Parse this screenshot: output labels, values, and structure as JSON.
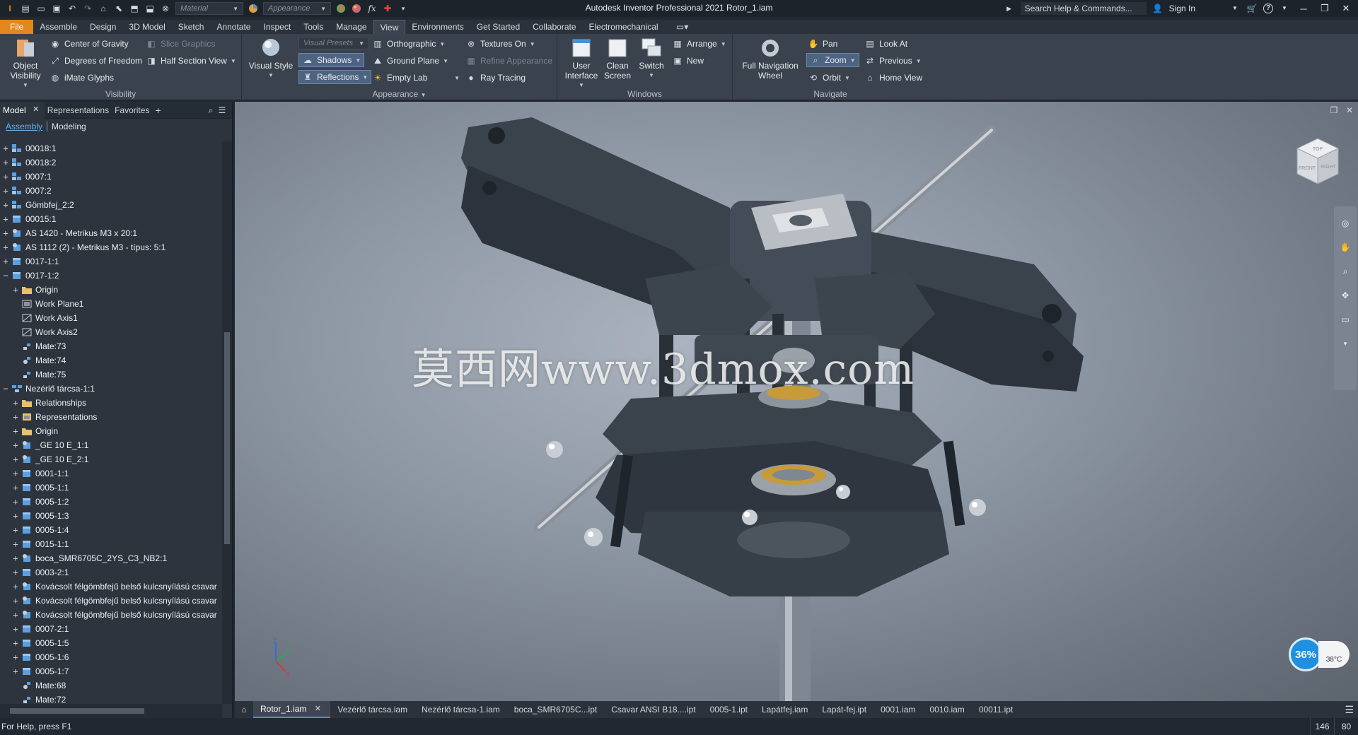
{
  "titlebar": {
    "app_title": "Autodesk Inventor Professional 2021   Rotor_1.iam",
    "material_placeholder": "Material",
    "appearance_placeholder": "Appearance",
    "search_text": "Search Help & Commands...",
    "sign_in": "Sign In"
  },
  "ribbon_tabs": [
    {
      "label": "File"
    },
    {
      "label": "Assemble"
    },
    {
      "label": "Design"
    },
    {
      "label": "3D Model"
    },
    {
      "label": "Sketch"
    },
    {
      "label": "Annotate"
    },
    {
      "label": "Inspect"
    },
    {
      "label": "Tools"
    },
    {
      "label": "Manage"
    },
    {
      "label": "View"
    },
    {
      "label": "Environments"
    },
    {
      "label": "Get Started"
    },
    {
      "label": "Collaborate"
    },
    {
      "label": "Electromechanical"
    }
  ],
  "ribbon": {
    "visibility": {
      "title": "Visibility",
      "object_visibility": "Object\nVisibility",
      "center_of_gravity": "Center of Gravity",
      "degrees_of_freedom": "Degrees of Freedom",
      "imate_glyphs": "iMate Glyphs",
      "slice_graphics": "Slice Graphics",
      "half_section_view": "Half Section View"
    },
    "appearance": {
      "title": "Appearance",
      "visual_style": "Visual Style",
      "visual_presets": "Visual Presets",
      "shadows": "Shadows",
      "reflections": "Reflections",
      "orthographic": "Orthographic",
      "ground_plane": "Ground Plane",
      "empty_lab": "Empty Lab",
      "textures_on": "Textures On",
      "refine_appearance": "Refine Appearance",
      "ray_tracing": "Ray Tracing"
    },
    "windows": {
      "title": "Windows",
      "user_interface": "User\nInterface",
      "clean_screen": "Clean\nScreen",
      "switch": "Switch",
      "arrange": "Arrange",
      "new": "New"
    },
    "navigate": {
      "title": "Navigate",
      "full_navigation_wheel": "Full Navigation\nWheel",
      "pan": "Pan",
      "zoom": "Zoom",
      "orbit": "Orbit",
      "look_at": "Look At",
      "previous": "Previous",
      "home_view": "Home View"
    }
  },
  "browser": {
    "tabs": {
      "model": "Model",
      "representations": "Representations",
      "favorites": "Favorites"
    },
    "sub": {
      "assembly": "Assembly",
      "modeling": "Modeling"
    },
    "nodes": [
      {
        "label": "00018:1",
        "indent": 0,
        "exp": "+",
        "icon": "assembly"
      },
      {
        "label": "00018:2",
        "indent": 0,
        "exp": "+",
        "icon": "assembly"
      },
      {
        "label": "0007:1",
        "indent": 0,
        "exp": "+",
        "icon": "assembly"
      },
      {
        "label": "0007:2",
        "indent": 0,
        "exp": "+",
        "icon": "assembly"
      },
      {
        "label": "Gömbfej_2:2",
        "indent": 0,
        "exp": "+",
        "icon": "assembly"
      },
      {
        "label": "00015:1",
        "indent": 0,
        "exp": "+",
        "icon": "part"
      },
      {
        "label": "AS 1420 - Metrikus M3 x 20:1",
        "indent": 0,
        "exp": "+",
        "icon": "cc"
      },
      {
        "label": "AS 1112 (2) - Metrikus M3  - típus: 5:1",
        "indent": 0,
        "exp": "+",
        "icon": "cc"
      },
      {
        "label": "0017-1:1",
        "indent": 0,
        "exp": "+",
        "icon": "part"
      },
      {
        "label": "0017-1:2",
        "indent": 0,
        "exp": "−",
        "icon": "part"
      },
      {
        "label": "Origin",
        "indent": 1,
        "exp": "+",
        "icon": "folder"
      },
      {
        "label": "Work Plane1",
        "indent": 1,
        "exp": "",
        "icon": "plane"
      },
      {
        "label": "Work Axis1",
        "indent": 1,
        "exp": "",
        "icon": "axis"
      },
      {
        "label": "Work Axis2",
        "indent": 1,
        "exp": "",
        "icon": "axis"
      },
      {
        "label": "Mate:73",
        "indent": 1,
        "exp": "",
        "icon": "mate"
      },
      {
        "label": "Mate:74",
        "indent": 1,
        "exp": "",
        "icon": "mate2"
      },
      {
        "label": "Mate:75",
        "indent": 1,
        "exp": "",
        "icon": "mate"
      },
      {
        "label": "Nezérlő tárcsa-1:1",
        "indent": 0,
        "exp": "−",
        "icon": "subasm"
      },
      {
        "label": "Relationships",
        "indent": 1,
        "exp": "+",
        "icon": "folder"
      },
      {
        "label": "Representations",
        "indent": 1,
        "exp": "+",
        "icon": "rep"
      },
      {
        "label": "Origin",
        "indent": 1,
        "exp": "+",
        "icon": "folder"
      },
      {
        "label": "_GE 10 E_1:1",
        "indent": 1,
        "exp": "+",
        "icon": "cc"
      },
      {
        "label": "_GE 10 E_2:1",
        "indent": 1,
        "exp": "+",
        "icon": "cc"
      },
      {
        "label": "0001-1:1",
        "indent": 1,
        "exp": "+",
        "icon": "part"
      },
      {
        "label": "0005-1:1",
        "indent": 1,
        "exp": "+",
        "icon": "part"
      },
      {
        "label": "0005-1:2",
        "indent": 1,
        "exp": "+",
        "icon": "part"
      },
      {
        "label": "0005-1:3",
        "indent": 1,
        "exp": "+",
        "icon": "part"
      },
      {
        "label": "0005-1:4",
        "indent": 1,
        "exp": "+",
        "icon": "part"
      },
      {
        "label": "0015-1:1",
        "indent": 1,
        "exp": "+",
        "icon": "part"
      },
      {
        "label": "boca_SMR6705C_2YS_C3_NB2:1",
        "indent": 1,
        "exp": "+",
        "icon": "cc"
      },
      {
        "label": "0003-2:1",
        "indent": 1,
        "exp": "+",
        "icon": "part"
      },
      {
        "label": "Kovácsolt félgömbfejű belső kulcsnyílású csavar",
        "indent": 1,
        "exp": "+",
        "icon": "cc"
      },
      {
        "label": "Kovácsolt félgömbfejű belső kulcsnyílású csavar",
        "indent": 1,
        "exp": "+",
        "icon": "cc"
      },
      {
        "label": "Kovácsolt félgömbfejű belső kulcsnyílású csavar",
        "indent": 1,
        "exp": "+",
        "icon": "cc"
      },
      {
        "label": "0007-2:1",
        "indent": 1,
        "exp": "+",
        "icon": "part"
      },
      {
        "label": "0005-1:5",
        "indent": 1,
        "exp": "+",
        "icon": "part"
      },
      {
        "label": "0005-1:6",
        "indent": 1,
        "exp": "+",
        "icon": "part"
      },
      {
        "label": "0005-1:7",
        "indent": 1,
        "exp": "+",
        "icon": "part"
      },
      {
        "label": "Mate:68",
        "indent": 1,
        "exp": "",
        "icon": "mate2"
      },
      {
        "label": "Mate:72",
        "indent": 1,
        "exp": "",
        "icon": "mate"
      }
    ]
  },
  "viewport": {
    "watermark": "莫西网www.3dmox.com",
    "perf_percent": "36%",
    "perf_temp": "38°C",
    "viewcube_front": "FRONT",
    "viewcube_right": "RIGHT",
    "viewcube_top": "TOP"
  },
  "doc_tabs": [
    {
      "label": "Rotor_1.iam",
      "active": true
    },
    {
      "label": "Vezérlő tárcsa.iam"
    },
    {
      "label": "Nezérlő tárcsa-1.iam"
    },
    {
      "label": "boca_SMR6705C...ipt"
    },
    {
      "label": "Csavar ANSI B18....ipt"
    },
    {
      "label": "0005-1.ipt"
    },
    {
      "label": "Lapátfej.iam"
    },
    {
      "label": "Lapát-fej.ipt"
    },
    {
      "label": "0001.iam"
    },
    {
      "label": "0010.iam"
    },
    {
      "label": "00011.ipt"
    }
  ],
  "statusbar": {
    "help": "For Help, press F1",
    "count1": "146",
    "count2": "80"
  }
}
